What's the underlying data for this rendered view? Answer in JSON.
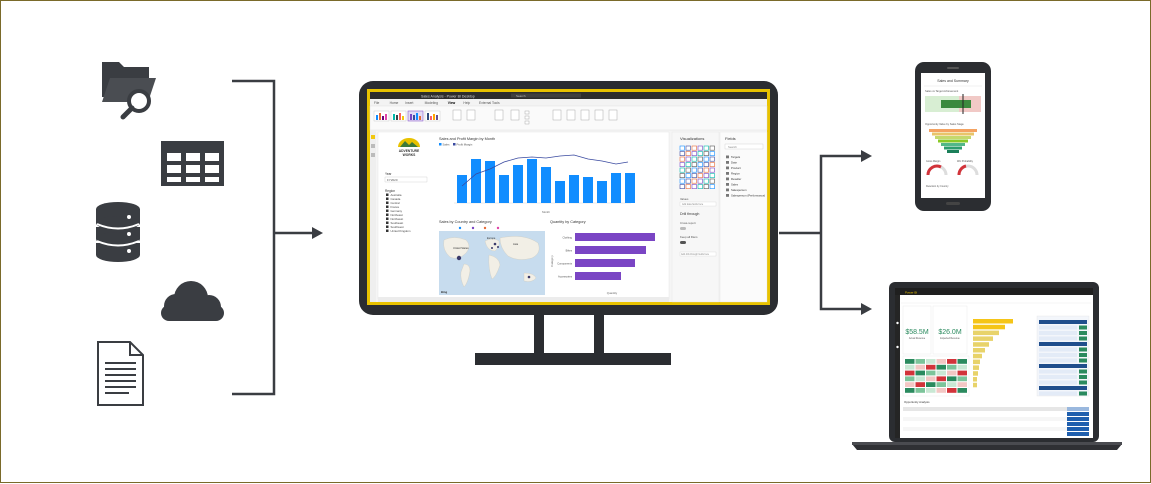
{
  "colors": {
    "frame_border": "#7a6a2a",
    "icon_dark": "#3a3d42",
    "monitor_bezel": "#2b2d31",
    "accent_yellow": "#e8c200",
    "bar_blue": "#118dff",
    "bar_purple": "#7a45c4",
    "line_navy": "#3a4aa0",
    "map_water": "#c7dcee",
    "map_land": "#f2efe6"
  },
  "source_icons": [
    "folder-search-icon",
    "table-icon",
    "database-icon",
    "cloud-icon",
    "document-icon"
  ],
  "monitor": {
    "window_title": "Sales Analysis - Power BI Desktop",
    "search_text": "Search",
    "ribbon_tabs": [
      "File",
      "Home",
      "Insert",
      "Modeling",
      "View",
      "Help",
      "External Tools"
    ],
    "active_tab": "View",
    "logo_line1": "ADVENTURE",
    "logo_line2": "WORKS",
    "slicer_year_label": "Year",
    "slicer_year_value": "FY2020",
    "slicer_region_label": "Region",
    "regions": [
      "Australia",
      "Canada",
      "Central",
      "France",
      "Germany",
      "Northeast",
      "Northwest",
      "Southeast",
      "Southwest",
      "United Kingdom"
    ],
    "chart1_title": "Sales and Profit Margin by Month",
    "chart1_legend": [
      "Sales",
      "Profit Margin"
    ],
    "chart1_xlabel": "Month",
    "chart2_title": "Sales by Country and Category",
    "chart3_title": "Quantity by Category",
    "chart3_xlabel": "Quantity",
    "chart3_ylabel": "Category",
    "chart3_categories": [
      "Clothing",
      "Bikes",
      "Components",
      "Accessories"
    ],
    "map_labels": [
      "United States",
      "Europe",
      "Asia"
    ],
    "map_brand": "Bing",
    "pane_visualizations": "Visualizations",
    "pane_fields": "Fields",
    "fields_search": "Search",
    "field_tables": [
      "Targets",
      "Date",
      "Product",
      "Region",
      "Reseller",
      "Sales",
      "Salesperson",
      "Salesperson (Performance)"
    ],
    "drill_through": "Drill through",
    "cross_report": "Cross-report",
    "keep_all_filters": "Keep all filters",
    "add_drill_fields": "Add drill-through fields here",
    "values_label": "Values",
    "add_data_fields": "Add data fields here"
  },
  "phone": {
    "title": "Sales and Summary",
    "section1": "Sales vs Target Achievement",
    "section2": "Opportunity Value by Sales Stage",
    "gauge1": "Gross Margin",
    "gauge2": "Win Probability",
    "footer": "Retention by Country"
  },
  "laptop": {
    "header_brand": "Power BI",
    "kpi1_value": "$58.5M",
    "kpi1_label": "Actual Revenue",
    "kpi2_value": "$26.0M",
    "kpi2_label": "Expected Revenue",
    "panel_title": "Opportunity Analysis"
  }
}
